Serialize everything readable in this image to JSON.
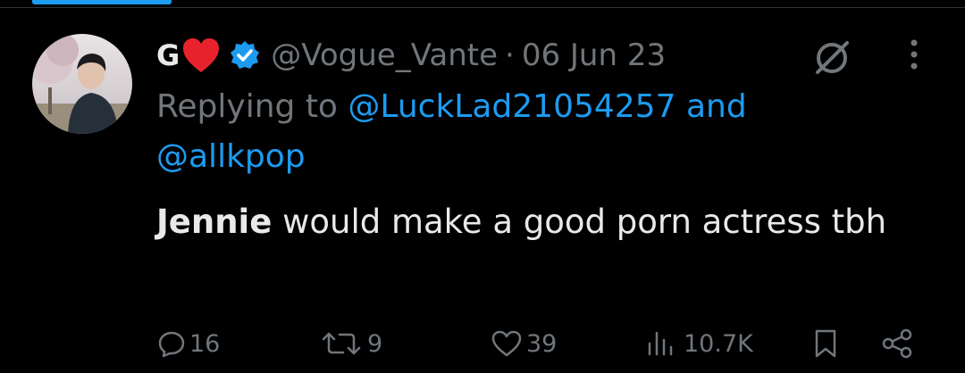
{
  "tweet": {
    "author_name": "G",
    "handle": "@Vogue_Vante",
    "separator": "·",
    "date": "06 Jun 23",
    "replying_prefix": "Replying to ",
    "replying_to_1": "@LuckLad21054257",
    "replying_and": " and",
    "replying_to_2": "@allkpop",
    "text_bold": "Jennie",
    "text_rest": " would make a good porn actress tbh"
  },
  "actions": {
    "replies": "16",
    "retweets": "9",
    "likes": "39",
    "views": "10.7K"
  },
  "icons": [
    "heart-emoji-icon",
    "verified-badge-icon",
    "muted-icon",
    "more-icon",
    "reply-icon",
    "retweet-icon",
    "like-icon",
    "views-icon",
    "bookmark-icon",
    "share-icon"
  ],
  "colors": {
    "accent": "#1d9bf0",
    "muted_text": "#71767b",
    "heart": "#e8222c"
  }
}
